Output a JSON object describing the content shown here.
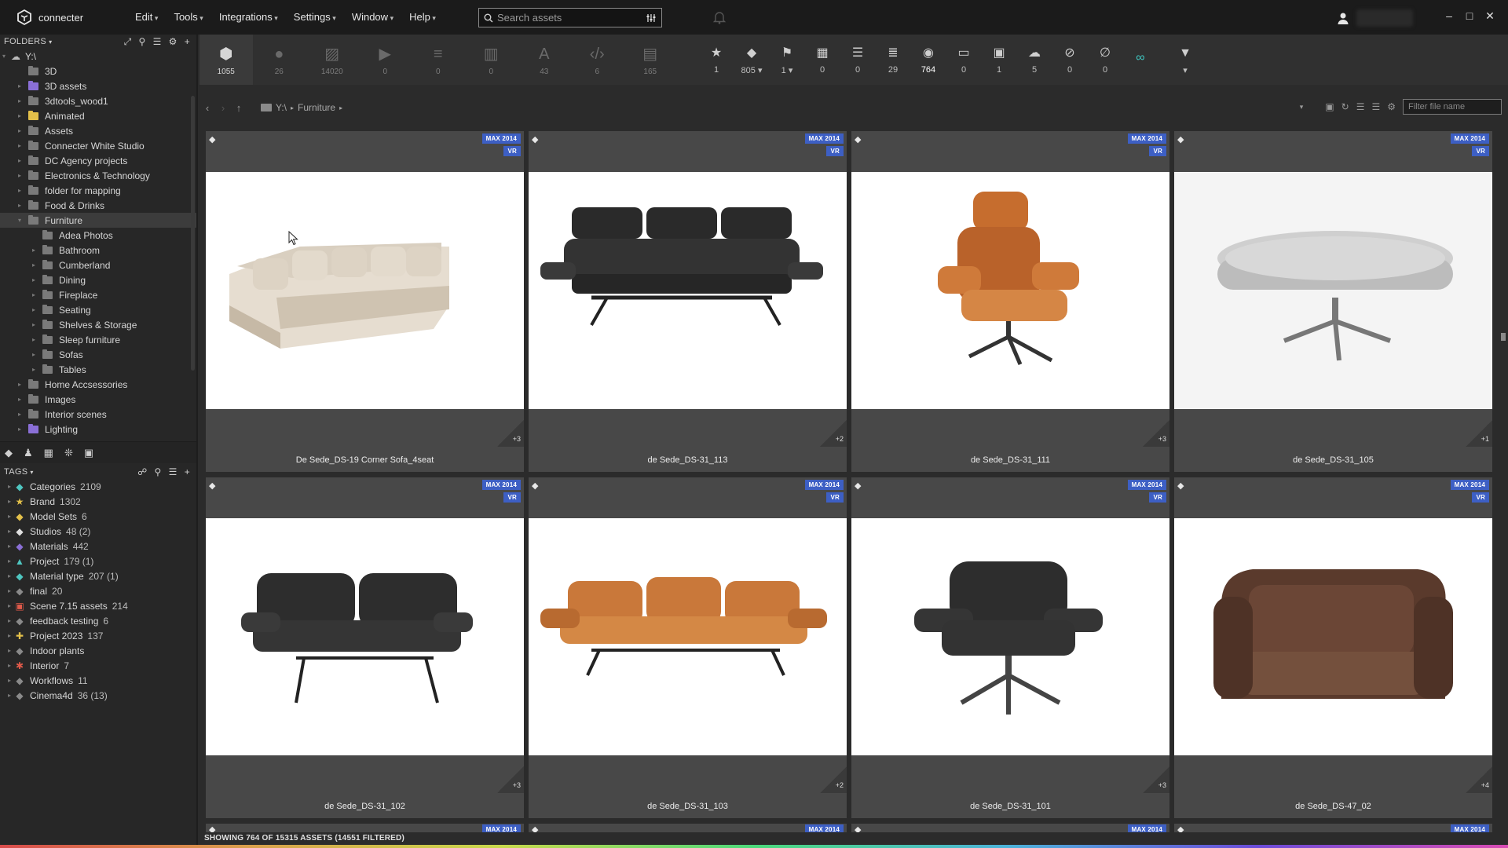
{
  "app": {
    "brand": "connecter"
  },
  "menus": [
    "Edit",
    "Tools",
    "Integrations",
    "Settings",
    "Window",
    "Help"
  ],
  "search": {
    "placeholder": "Search assets"
  },
  "sidebar": {
    "folders_label": "FOLDERS",
    "root": "Y:\\",
    "folders": [
      {
        "label": "3D",
        "color": "#7a7a7a",
        "arrow": ""
      },
      {
        "label": "3D assets",
        "color": "#8a6fd6",
        "arrow": "▸"
      },
      {
        "label": "3dtools_wood1",
        "color": "#7a7a7a",
        "arrow": "▸"
      },
      {
        "label": "Animated",
        "color": "#e3c04a",
        "arrow": "▸"
      },
      {
        "label": "Assets",
        "color": "#7a7a7a",
        "arrow": "▸"
      },
      {
        "label": "Connecter White Studio",
        "color": "#7a7a7a",
        "arrow": "▸"
      },
      {
        "label": "DC Agency projects",
        "color": "#7a7a7a",
        "arrow": "▸"
      },
      {
        "label": "Electronics & Technology",
        "color": "#7a7a7a",
        "arrow": "▸"
      },
      {
        "label": "folder for mapping",
        "color": "#7a7a7a",
        "arrow": "▸"
      },
      {
        "label": "Food & Drinks",
        "color": "#7a7a7a",
        "arrow": "▸"
      },
      {
        "label": "Furniture",
        "color": "#7a7a7a",
        "arrow": "▾",
        "selected": true
      },
      {
        "label": "Adea Photos",
        "color": "#7a7a7a",
        "arrow": "",
        "child": true
      },
      {
        "label": "Bathroom",
        "color": "#7a7a7a",
        "arrow": "▸",
        "child": true
      },
      {
        "label": "Cumberland",
        "color": "#7a7a7a",
        "arrow": "▸",
        "child": true
      },
      {
        "label": "Dining",
        "color": "#7a7a7a",
        "arrow": "▸",
        "child": true
      },
      {
        "label": "Fireplace",
        "color": "#7a7a7a",
        "arrow": "▸",
        "child": true
      },
      {
        "label": "Seating",
        "color": "#7a7a7a",
        "arrow": "▸",
        "child": true
      },
      {
        "label": "Shelves & Storage",
        "color": "#7a7a7a",
        "arrow": "▸",
        "child": true
      },
      {
        "label": "Sleep furniture",
        "color": "#7a7a7a",
        "arrow": "▸",
        "child": true
      },
      {
        "label": "Sofas",
        "color": "#7a7a7a",
        "arrow": "▸",
        "child": true
      },
      {
        "label": "Tables",
        "color": "#7a7a7a",
        "arrow": "▸",
        "child": true
      },
      {
        "label": "Home Accsessories",
        "color": "#7a7a7a",
        "arrow": "▸"
      },
      {
        "label": "Images",
        "color": "#7a7a7a",
        "arrow": "▸"
      },
      {
        "label": "Interior scenes",
        "color": "#7a7a7a",
        "arrow": "▸"
      },
      {
        "label": "Lighting",
        "color": "#8a6fd6",
        "arrow": "▸"
      }
    ],
    "tags_label": "TAGS",
    "tags": [
      {
        "label": "Categories",
        "count": "2109",
        "icon": "◆",
        "color": "#4fc6c0"
      },
      {
        "label": "Brand",
        "count": "1302",
        "icon": "★",
        "color": "#e3c04a"
      },
      {
        "label": "Model Sets",
        "count": "6",
        "icon": "◆",
        "color": "#e3c04a"
      },
      {
        "label": "Studios",
        "count": "48 (2)",
        "icon": "◆",
        "color": "#e0e0e0"
      },
      {
        "label": "Materials",
        "count": "442",
        "icon": "◆",
        "color": "#8a6fd6"
      },
      {
        "label": "Project",
        "count": "179 (1)",
        "icon": "▲",
        "color": "#4fc6c0"
      },
      {
        "label": "Material type",
        "count": "207 (1)",
        "icon": "◆",
        "color": "#4fc6c0"
      },
      {
        "label": "final",
        "count": "20",
        "icon": "◆",
        "color": "#8a8a8a"
      },
      {
        "label": "Scene 7.15 assets",
        "count": "214",
        "icon": "▣",
        "color": "#e05a4a"
      },
      {
        "label": "feedback testing",
        "count": "6",
        "icon": "◆",
        "color": "#8a8a8a"
      },
      {
        "label": "Project 2023",
        "count": "137",
        "icon": "✚",
        "color": "#e3c04a"
      },
      {
        "label": "Indoor plants",
        "count": "",
        "icon": "◆",
        "color": "#8a8a8a"
      },
      {
        "label": "Interior",
        "count": "7",
        "icon": "✱",
        "color": "#e05a4a"
      },
      {
        "label": "Workflows",
        "count": "11",
        "icon": "◆",
        "color": "#8a8a8a"
      },
      {
        "label": "Cinema4d",
        "count": "36 (13)",
        "icon": "◆",
        "color": "#8a8a8a"
      }
    ]
  },
  "toolbar": {
    "types": [
      {
        "icon": "cube-icon",
        "glyph": "⬢",
        "value": "1055"
      },
      {
        "icon": "material-icon",
        "glyph": "●",
        "value": "26"
      },
      {
        "icon": "image-icon",
        "glyph": "▨",
        "value": "14020"
      },
      {
        "icon": "video-icon",
        "glyph": "▶",
        "value": "0"
      },
      {
        "icon": "audio-icon",
        "glyph": "≡",
        "value": "0"
      },
      {
        "icon": "document-icon",
        "glyph": "▥",
        "value": "0"
      },
      {
        "icon": "font-icon",
        "glyph": "A",
        "value": "43"
      },
      {
        "icon": "code-icon",
        "glyph": "‹/›",
        "value": "6"
      },
      {
        "icon": "file-icon",
        "glyph": "▤",
        "value": "165"
      }
    ],
    "filters": [
      {
        "icon": "star-icon",
        "glyph": "★",
        "value": "1"
      },
      {
        "icon": "tag-icon",
        "glyph": "◆",
        "value": "805 ▾"
      },
      {
        "icon": "flag-icon",
        "glyph": "⚑",
        "value": "1 ▾"
      },
      {
        "icon": "grid-icon",
        "glyph": "▦",
        "value": "0"
      },
      {
        "icon": "list-icon",
        "glyph": "☰",
        "value": "0"
      },
      {
        "icon": "align-icon",
        "glyph": "≣",
        "value": "29"
      },
      {
        "icon": "camera-icon",
        "glyph": "◉",
        "value": "764",
        "active": true
      },
      {
        "icon": "comment-icon",
        "glyph": "▭",
        "value": "0"
      },
      {
        "icon": "puzzle-icon",
        "glyph": "▣",
        "value": "1"
      },
      {
        "icon": "cloud-icon",
        "glyph": "☁",
        "value": "5"
      },
      {
        "icon": "hidden-icon",
        "glyph": "⊘",
        "value": "0"
      },
      {
        "icon": "blocked-icon",
        "glyph": "∅",
        "value": "0"
      },
      {
        "icon": "vr-icon",
        "glyph": "∞",
        "value": ""
      },
      {
        "icon": "funnel-icon",
        "glyph": "▼",
        "value": "▾"
      }
    ]
  },
  "path": {
    "root": "Y:\\",
    "folder": "Furniture"
  },
  "filter_placeholder": "Filter file name",
  "badges": {
    "max": "MAX 2014",
    "vr": "VR"
  },
  "assets": [
    {
      "name": "De Sede_DS-19 Corner Sofa_4seat",
      "extra": "+3"
    },
    {
      "name": "de Sede_DS-31_113",
      "extra": "+2"
    },
    {
      "name": "de Sede_DS-31_111",
      "extra": "+3"
    },
    {
      "name": "de Sede_DS-31_105",
      "extra": "+1"
    },
    {
      "name": "de Sede_DS-31_102",
      "extra": "+3"
    },
    {
      "name": "de Sede_DS-31_103",
      "extra": "+2"
    },
    {
      "name": "de Sede_DS-31_101",
      "extra": "+3"
    },
    {
      "name": "de Sede_DS-47_02",
      "extra": "+4"
    }
  ],
  "status": "SHOWING 764 OF 15315 ASSETS (14551 FILTERED)"
}
